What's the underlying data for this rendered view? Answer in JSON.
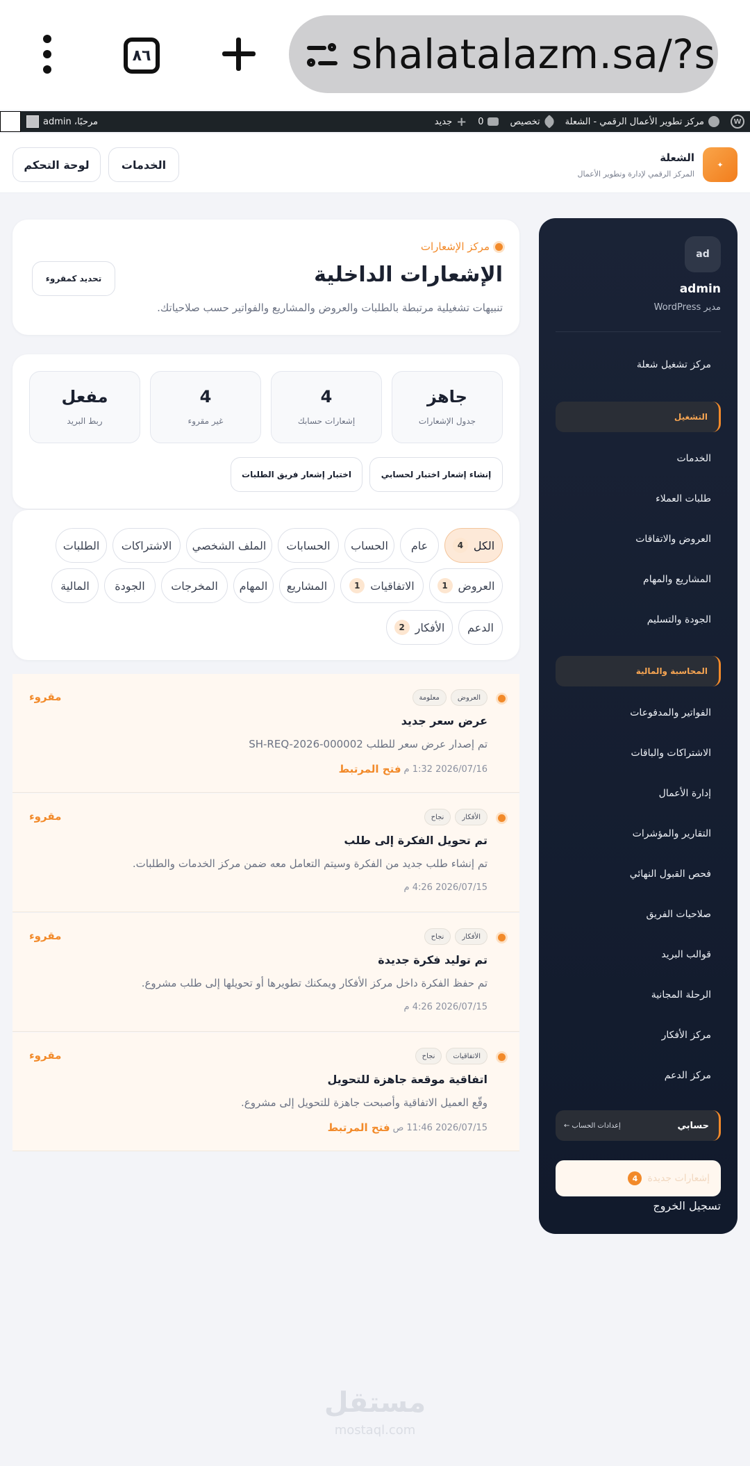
{
  "browser": {
    "url": "shalatalazm.sa/?s",
    "tab_count": "٨٦"
  },
  "admin_bar": {
    "site_name": "مركز تطوير الأعمال الرقمي - الشعلة",
    "customize": "تخصيص",
    "comments_count": "0",
    "new": "جديد",
    "greeting": "مرحبًا، admin"
  },
  "header": {
    "brand_name": "الشعلة",
    "brand_tagline": "المركز الرقمي لإدارة وتطوير الأعمال",
    "services_button": "الخدمات",
    "dashboard_button": "لوحة التحكم"
  },
  "sidebar": {
    "avatar_initials": "ad",
    "user_name": "admin",
    "user_role": "مدير WordPress",
    "home_link": "مركز تشغيل شعلة",
    "operations_section": "التشغيل",
    "operations_items": [
      "الخدمات",
      "طلبات العملاء",
      "العروض والاتفاقات",
      "المشاريع والمهام",
      "الجودة والتسليم"
    ],
    "finance_section": "المحاسبة والمالية",
    "finance_items": [
      "الفواتير والمدفوعات",
      "الاشتراكات والباقات",
      "إدارة الأعمال",
      "التقارير والمؤشرات",
      "فحص القبول النهائي",
      "صلاحيات الفريق",
      "قوالب البريد",
      "الرحلة المجانية",
      "مركز الأفكار",
      "مركز الدعم"
    ],
    "account_label": "حسابي",
    "account_settings": "إعدادات الحساب ←",
    "new_notifications_label": "إشعارات جديدة",
    "new_notifications_count": "4",
    "logout": "تسجيل الخروج"
  },
  "page": {
    "eyebrow": "مركز الإشعارات",
    "title": "الإشعارات الداخلية",
    "subtitle": "تنبيهات تشغيلية مرتبطة بالطلبات والعروض والمشاريع والفواتير حسب صلاحياتك.",
    "mark_all_read": "تحديد كمقروء"
  },
  "stats": [
    {
      "value": "جاهز",
      "label": "جدول الإشعارات"
    },
    {
      "value": "4",
      "label": "إشعارات حسابك"
    },
    {
      "value": "4",
      "label": "غير مقروء"
    },
    {
      "value": "مفعل",
      "label": "ربط البريد"
    }
  ],
  "test_buttons": {
    "my_account": "إنشاء إشعار اختبار لحسابي",
    "requests_team": "اختبار إشعار فريق الطلبات"
  },
  "filters": {
    "row1": [
      {
        "label": "الكل",
        "count": "4",
        "active": true
      },
      {
        "label": "عام"
      },
      {
        "label": "الحساب"
      },
      {
        "label": "الحسابات"
      },
      {
        "label": "الملف الشخصي"
      },
      {
        "label": "الاشتراكات"
      },
      {
        "label": "الطلبات"
      }
    ],
    "row2": [
      {
        "label": "العروض",
        "count": "1"
      },
      {
        "label": "الاتفاقيات",
        "count": "1"
      },
      {
        "label": "المشاريع"
      },
      {
        "label": "المهام"
      },
      {
        "label": "المخرجات"
      },
      {
        "label": "الجودة"
      },
      {
        "label": "المالية"
      }
    ],
    "row3": [
      {
        "label": "الدعم"
      },
      {
        "label": "الأفكار",
        "count": "2"
      }
    ]
  },
  "notifications": [
    {
      "tags": [
        "العروض",
        "معلومة"
      ],
      "title": "عرض سعر جديد",
      "description": "تم إصدار عرض سعر للطلب SH-REQ-2026-000002",
      "date": "2026/07/16 1:32 م",
      "open_link": "فتح المرتبط",
      "status": "مقروء"
    },
    {
      "tags": [
        "الأفكار",
        "نجاح"
      ],
      "title": "تم تحويل الفكرة إلى طلب",
      "description": "تم إنشاء طلب جديد من الفكرة وسيتم التعامل معه ضمن مركز الخدمات والطلبات.",
      "date": "2026/07/15 4:26 م",
      "open_link": "",
      "status": "مقروء"
    },
    {
      "tags": [
        "الأفكار",
        "نجاح"
      ],
      "title": "تم توليد فكرة جديدة",
      "description": "تم حفظ الفكرة داخل مركز الأفكار ويمكنك تطويرها أو تحويلها إلى طلب مشروع.",
      "date": "2026/07/15 4:26 م",
      "open_link": "",
      "status": "مقروء"
    },
    {
      "tags": [
        "الاتفاقيات",
        "نجاح"
      ],
      "title": "اتفاقية موقعة جاهزة للتحويل",
      "description": "وقّع العميل الاتفاقية وأصبحت جاهزة للتحويل إلى مشروع.",
      "date": "2026/07/15 11:46 ص",
      "open_link": "فتح المرتبط",
      "status": "مقروء"
    }
  ],
  "watermark": {
    "brand": "مستقل",
    "domain": "mostaql.com"
  },
  "colors": {
    "accent": "#f28a2a",
    "sidebar_bg": "#141d30",
    "admin_bar": "#1d2327"
  }
}
